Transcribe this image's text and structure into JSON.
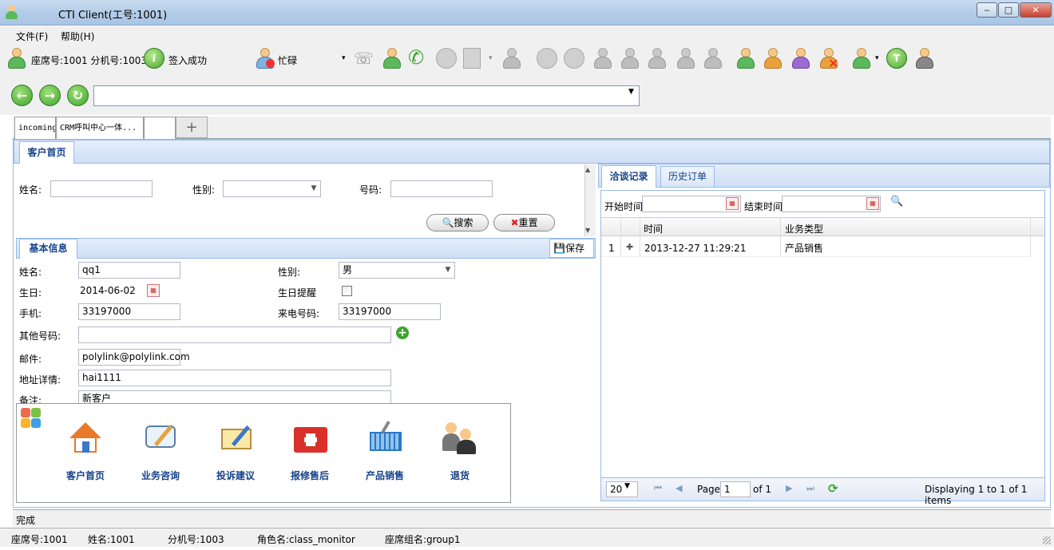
{
  "window": {
    "title": "CTI Client(工号:1001)",
    "minimize": "‒",
    "maximize": "□",
    "close": "✕"
  },
  "menu": {
    "file": "文件(F)",
    "help": "帮助(H)"
  },
  "toolbar": {
    "seat_info": "座席号:1001 分机号:1003",
    "sign_status": "签入成功",
    "agent_state": "忙碌"
  },
  "tabs": [
    {
      "label": "incoming"
    },
    {
      "label": "CRM呼叫中心一体..."
    },
    {
      "label": ""
    }
  ],
  "add_tab": "+",
  "panel": {
    "title": "客户首页"
  },
  "search": {
    "name_label": "姓名:",
    "gender_label": "性别:",
    "number_label": "号码:",
    "search_button": "搜索",
    "reset_button": "重置"
  },
  "basic": {
    "title": "基本信息",
    "save": "保存",
    "name_label": "姓名:",
    "name_value": "qq1",
    "gender_label": "性别:",
    "gender_value": "男",
    "birthday_label": "生日:",
    "birthday_value": "2014-06-02",
    "birthday_reminder_label": "生日提醒",
    "mobile_label": "手机:",
    "mobile_value": "33197000",
    "caller_label": "来电号码:",
    "caller_value": "33197000",
    "other_label": "其他号码:",
    "email_label": "邮件:",
    "email_value": "polylink@polylink.com",
    "address_label": "地址详情:",
    "address_value": "hai1111",
    "remark_label": "备注:",
    "remark_value": "新客户"
  },
  "launcher": [
    "客户首页",
    "业务咨询",
    "投诉建议",
    "报修售后",
    "产品销售",
    "退货"
  ],
  "right": {
    "tab_records": "洽谈记录",
    "tab_orders": "历史订单",
    "start_label": "开始时间",
    "end_label": "结束时间",
    "columns": [
      "时间",
      "业务类型"
    ],
    "rows": [
      {
        "index": "1",
        "expand": "✚",
        "time": "2013-12-27 11:29:21",
        "type": "产品销售"
      }
    ],
    "page_size": "20",
    "page_label": "Page",
    "page_value": "1",
    "of_label": "of 1",
    "displaying": "Displaying 1 to 1 of 1 items"
  },
  "status": {
    "done": "完成",
    "seat": "座席号:1001",
    "name": "姓名:1001",
    "ext": "分机号:1003",
    "role": "角色名:class_monitor",
    "group": "座席组名:group1"
  }
}
